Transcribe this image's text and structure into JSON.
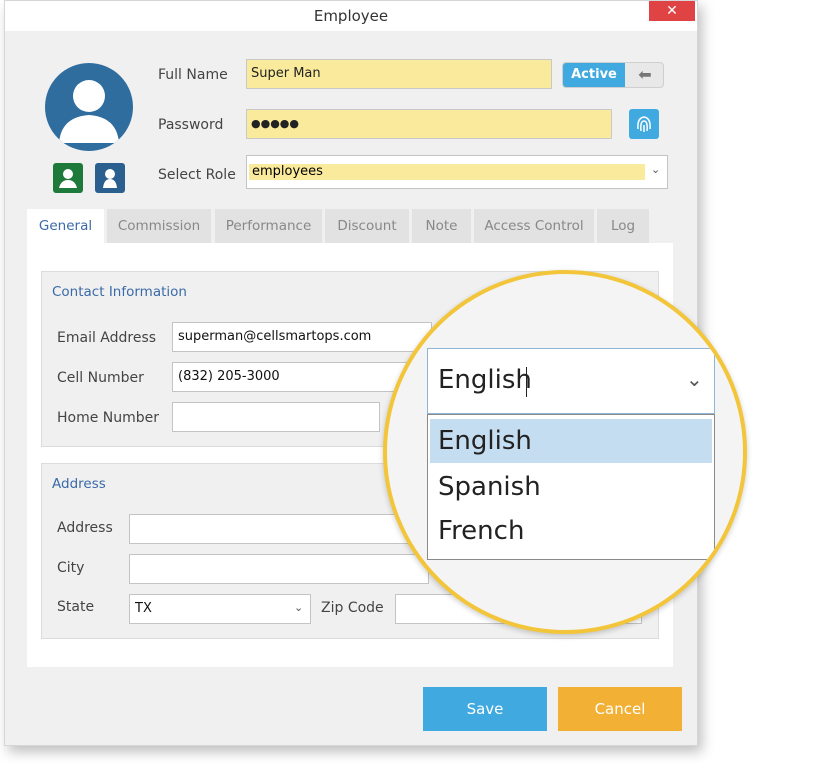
{
  "window": {
    "title": "Employee",
    "close_label": "✕"
  },
  "profile": {
    "full_name_label": "Full Name",
    "full_name_value": "Super Man",
    "status_label": "Active",
    "password_label": "Password",
    "password_value": "●●●●●",
    "role_label": "Select Role",
    "role_value": "employees"
  },
  "tabs": [
    "General",
    "Commission",
    "Performance",
    "Discount",
    "Note",
    "Access Control",
    "Log"
  ],
  "contact": {
    "title": "Contact Information",
    "email_label": "Email Address",
    "email_value": "superman@cellsmartops.com",
    "cell_label": "Cell Number",
    "cell_value": "(832) 205-3000",
    "home_label": "Home Number",
    "home_value": ""
  },
  "address": {
    "title": "Address",
    "address_label": "Address",
    "city_label": "City",
    "state_label": "State",
    "state_value": "TX",
    "zip_label": "Zip Code"
  },
  "language": {
    "selected": "English",
    "options": [
      "English",
      "Spanish",
      "French"
    ]
  },
  "footer": {
    "save_label": "Save",
    "cancel_label": "Cancel"
  },
  "colors": {
    "accent": "#3fa9e0",
    "cancel": "#f2b035",
    "highlight": "#f2c53a",
    "input_yellow": "#faeb9c"
  }
}
